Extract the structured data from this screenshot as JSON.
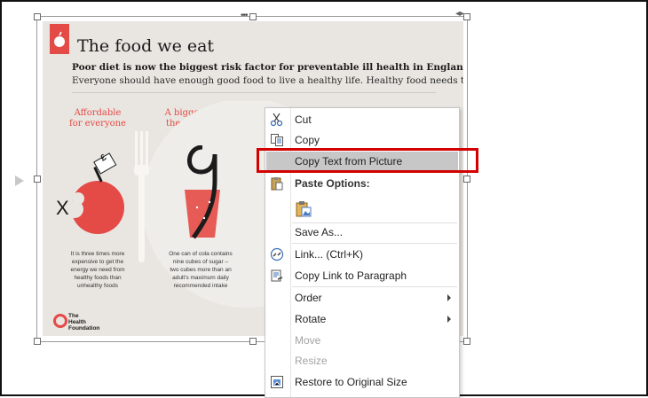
{
  "poster": {
    "title": "The food we eat",
    "lead_bold": "Poor diet is now the biggest risk factor for preventable ill health in England.",
    "lead_text": "Everyone should have enough good food to live a healthy life. Healthy food needs to be:",
    "columns": [
      {
        "heading_line1": "Affordable",
        "heading_line2": "for everyone",
        "note": [
          "It is three times more",
          "expensive to get the",
          "energy we need from",
          "healthy foods than",
          "unhealthy foods"
        ]
      },
      {
        "heading_line1": "A bigger part of",
        "heading_line2": "the food supply",
        "note": [
          "One can of cola contains",
          "nine cubes of sugar –",
          "two cubes more than an",
          "adult's maximum daily",
          "recommended intake"
        ]
      }
    ],
    "apple_mark": "X",
    "price_tag": "£",
    "brand": {
      "line1": "The",
      "line2": "Health",
      "line3": "Foundation"
    },
    "colors": {
      "accent": "#e44a46",
      "background": "#e9e6e1"
    }
  },
  "menu": {
    "items": [
      {
        "label": "Cut",
        "icon": "scissors-icon"
      },
      {
        "label": "Copy",
        "icon": "copy-icon"
      },
      {
        "label": "Copy Text from Picture",
        "icon": ""
      },
      {
        "label": "Paste Options:",
        "icon": "clipboard-icon"
      },
      {
        "label": "",
        "icon": "paste-picture-icon"
      },
      {
        "label": "Save As...",
        "icon": ""
      },
      {
        "label": "Link...  (Ctrl+K)",
        "icon": "link-icon"
      },
      {
        "label": "Copy Link to Paragraph",
        "icon": "paragraph-link-icon"
      },
      {
        "label": "Order",
        "icon": ""
      },
      {
        "label": "Rotate",
        "icon": ""
      },
      {
        "label": "Move",
        "icon": ""
      },
      {
        "label": "Resize",
        "icon": ""
      },
      {
        "label": "Restore to Original Size",
        "icon": "restore-size-icon"
      }
    ],
    "highlight_color": "#d20000"
  }
}
